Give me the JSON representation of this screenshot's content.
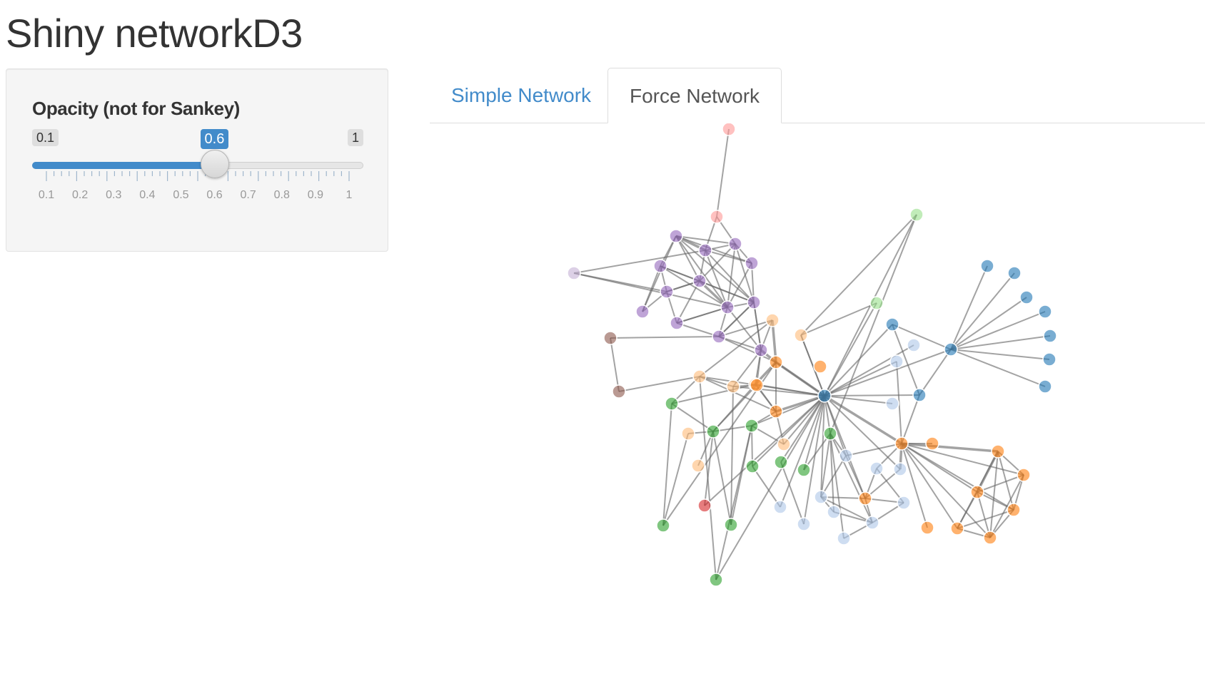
{
  "app": {
    "title": "Shiny networkD3"
  },
  "sidebar": {
    "slider": {
      "label": "Opacity (not for Sankey)",
      "min": 0.1,
      "max": 1,
      "value": 0.6,
      "min_label": "0.1",
      "max_label": "1",
      "value_label": "0.6",
      "tick_labels": [
        "0.1",
        "0.2",
        "0.3",
        "0.4",
        "0.5",
        "0.6",
        "0.7",
        "0.8",
        "0.9",
        "1"
      ]
    }
  },
  "tabs": [
    {
      "label": "Simple Network",
      "active": false
    },
    {
      "label": "Force Network",
      "active": true
    }
  ],
  "colors": {
    "accent": "#428bca",
    "link": "#666666",
    "groups": [
      "#1f77b4",
      "#aec7e8",
      "#ff7f0e",
      "#ffbb78",
      "#2ca02c",
      "#98df8a",
      "#d62728",
      "#ff9896",
      "#9467bd",
      "#c5b0d5",
      "#8c564b"
    ]
  },
  "network": {
    "opacity": 0.6
  }
}
